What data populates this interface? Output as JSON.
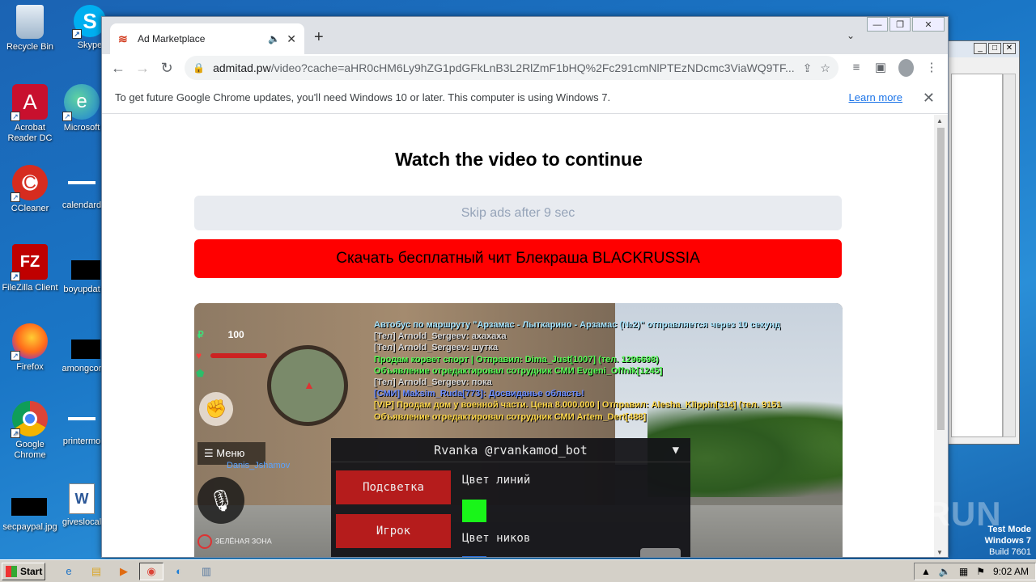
{
  "desktop": {
    "icons": [
      {
        "label": "Recycle Bin",
        "symbol": "🗑"
      },
      {
        "label": "Skype",
        "symbol": "S"
      },
      {
        "label": "Acrobat Reader DC",
        "symbol": "A"
      },
      {
        "label": "Microsoft",
        "symbol": "e"
      },
      {
        "label": "CCleaner",
        "symbol": "C"
      },
      {
        "label": "calendard",
        "symbol": ""
      },
      {
        "label": "FileZilla Client",
        "symbol": "FZ"
      },
      {
        "label": "boyupdat",
        "symbol": ""
      },
      {
        "label": "Firefox",
        "symbol": "🦊"
      },
      {
        "label": "amongcor",
        "symbol": ""
      },
      {
        "label": "Google Chrome",
        "symbol": "◉"
      },
      {
        "label": "printermo",
        "symbol": ""
      },
      {
        "label": "secpaypal.jpg",
        "symbol": ""
      },
      {
        "label": "giveslocal",
        "symbol": "W"
      }
    ],
    "watermark": "ANY RUN",
    "test_mode": {
      "line1": "Test Mode",
      "line2": "Windows 7",
      "line3": "Build 7601"
    }
  },
  "browser": {
    "tab": {
      "title": "Ad Marketplace",
      "favicon": "≋",
      "audio_icon": "🔈",
      "close": "✕"
    },
    "new_tab": "+",
    "tab_search": "⌄",
    "url": {
      "host": "admitad.pw",
      "path": "/video?cache=aHR0cHM6Ly9hZG1pdGFkLnB3L2RlZmF1bHQ%2Fc291cmNlPTEzNDcmc3ViaWQ9TF..."
    },
    "info_bar": {
      "message": "To get future Google Chrome updates, you'll need Windows 10 or later. This computer is using Windows 7.",
      "learn_more": "Learn more",
      "close": "✕"
    }
  },
  "page": {
    "headline": "Watch the video to continue",
    "skip_text": "Skip ads after 9 sec",
    "download_button": "Скачать бесплатный чит Блекраша BLACKRUSSIA",
    "accent_red": "#ff0000"
  },
  "video": {
    "money": "100",
    "chat": [
      {
        "text": "Автобус по маршруту \"Арзамас - Лыткарино - Арзамас (№2)\" отправляется через 10 секунд",
        "color": "#a8e6ff"
      },
      {
        "text": "[Тел] Arnold_Sergeev: ахахаха",
        "color": "#d8d8d8"
      },
      {
        "text": "[Тел] Arnold_Sergeev: шутка",
        "color": "#d8d8d8"
      },
      {
        "text": "Продам корвет спорт | Отправил: Dima_Just[1007] (тел. 1296698)",
        "color": "#55ff55"
      },
      {
        "text": "Объявление отредактировал сотрудник СМИ Evgeni_Offnik[1245]",
        "color": "#55ff55"
      },
      {
        "text": "[Тел] Arnold_Sergeev: пока",
        "color": "#d8d8d8"
      },
      {
        "text": "[СМИ] Maksim_Ruda[773]: Досвиданье область!",
        "color": "#6a8cff"
      },
      {
        "text": "[VIP] Продам дом у военной части. Цена 8.000.000 | Отправил: Alesha_Klippin[314] (тел. 9151",
        "color": "#ffd84a"
      },
      {
        "text": "Объявление отредактировал сотрудник СМИ Artem_Dert[488]",
        "color": "#ffd84a"
      }
    ],
    "menu_label": "Меню",
    "nickname": "Danis_Jshamov",
    "zone": "ЗЕЛЁНАЯ ЗОНА",
    "cheat_menu": {
      "title": "Rvanka @rvankamod_bot",
      "buttons": [
        "Подсветка",
        "Игрок"
      ],
      "line_color_label": "Цвет линий",
      "nick_color_label": "Цвет ников",
      "swatch_color": "#19f519"
    }
  },
  "taskbar": {
    "start_label": "Start",
    "time": "9:02 AM",
    "apps": [
      "ie-icon",
      "explorer-icon",
      "media-player-icon",
      "chrome-icon",
      "edge-icon",
      "notepad-icon"
    ]
  }
}
